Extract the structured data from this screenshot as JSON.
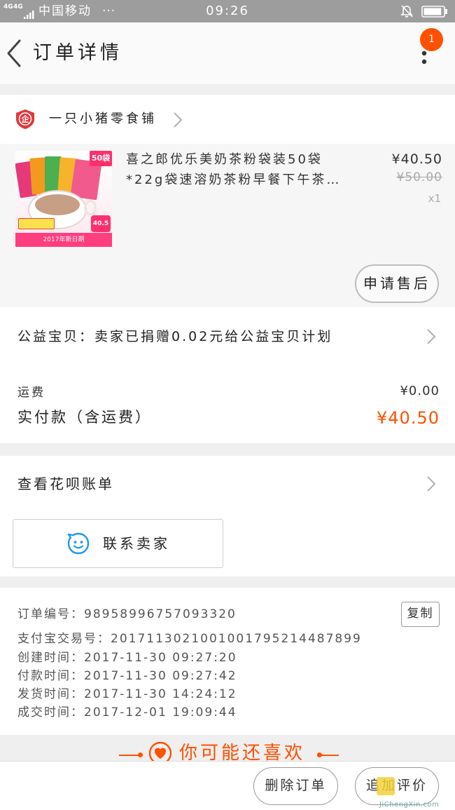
{
  "status_bar": {
    "network_1": "4G",
    "network_2": "4G",
    "carrier": "中国移动",
    "carrier_more": "···",
    "time": "09:26",
    "battery_level": 0.92,
    "icons": [
      "signal-icon",
      "bell-off-icon",
      "battery-icon"
    ]
  },
  "header": {
    "title": "订单详情",
    "badge_count": "1",
    "icons": {
      "back": "chevron-left-icon",
      "more": "more-vert-icon"
    }
  },
  "shop": {
    "logo_char": "企",
    "name": "一只小猪零食铺",
    "icons": {
      "logo": "shop-badge-icon",
      "open": "chevron-right-icon"
    }
  },
  "product": {
    "title_lines": [
      "喜之郎优乐美奶茶粉袋装50袋",
      "*22g袋速溶奶茶粉早餐下午茶…"
    ],
    "price": "¥40.50",
    "original_price": "¥50.00",
    "quantity": "x1",
    "image_text": {
      "count_tag": "50袋",
      "price_tag": "40.5",
      "date_banner": "2017年新日期"
    },
    "after_sale_button": "申请售后"
  },
  "charity": {
    "text": "公益宝贝：卖家已捐赠0.02元给公益宝贝计划"
  },
  "payment": {
    "shipping_label": "运费",
    "shipping_value": "¥0.00",
    "total_label": "实付款（含运费）",
    "total_value": "¥40.50"
  },
  "huabei": {
    "label": "查看花呗账单"
  },
  "contact": {
    "label": "联系卖家",
    "icon": "chat-smile-icon"
  },
  "order_info": {
    "copy_button": "复制",
    "rows": [
      {
        "label": "订单编号：",
        "value": "98958996757093320"
      },
      {
        "label": "支付宝交易号：",
        "value": "2017113021001001795214487899"
      },
      {
        "label": "创建时间：",
        "value": "2017-11-30 09:27:20"
      },
      {
        "label": "付款时间：",
        "value": "2017-11-30 09:27:42"
      },
      {
        "label": "发货时间：",
        "value": "2017-11-30 14:24:12"
      },
      {
        "label": "成交时间：",
        "value": "2017-12-01 19:09:44"
      }
    ]
  },
  "recommend": {
    "title": "你可能还喜欢",
    "icon": "heart-icon"
  },
  "bottom_bar": {
    "delete_button": "删除订单",
    "review_button": "追加评价"
  },
  "watermark": {
    "text": "JiChengXin.com"
  },
  "colors": {
    "accent": "#ff5000",
    "status_bar": "#9d9d9d",
    "contact_icon": "#1a9bf0",
    "shop_logo": "#e0393e"
  }
}
